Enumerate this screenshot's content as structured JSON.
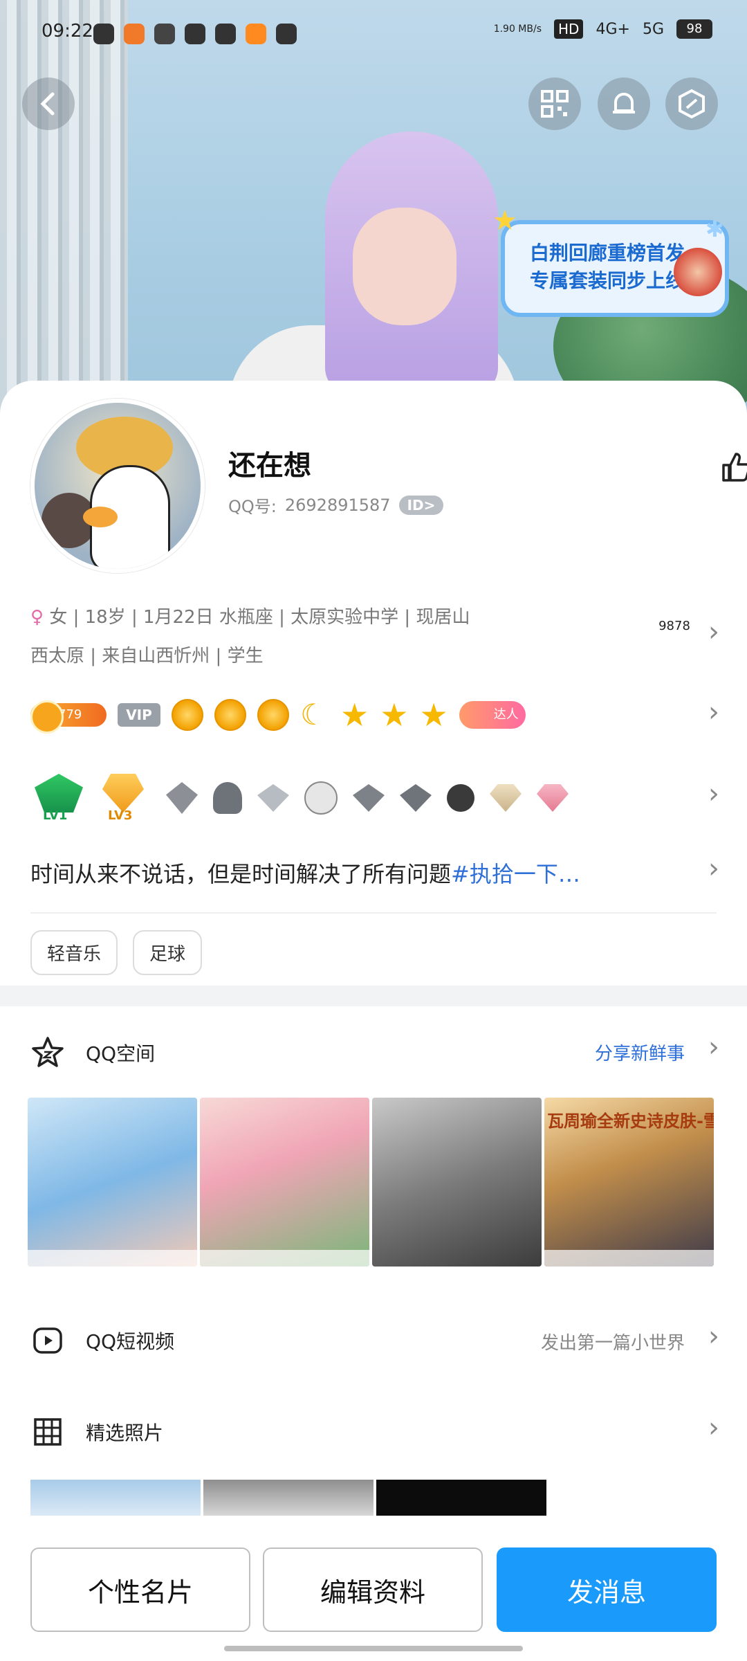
{
  "status_bar": {
    "time": "09:22",
    "net_speed": "1.90 MB/s",
    "hd": "HD",
    "net1": "4G+",
    "net2": "5G",
    "battery": "98"
  },
  "header": {
    "back_icon": "chevron-left-icon",
    "qr_icon": "qr-code-icon",
    "bell_icon": "bell-icon",
    "hex_icon": "hexagon-icon",
    "banner_line1": "白荆回廊重榜首发",
    "banner_line2": "专属套装同步上线"
  },
  "profile": {
    "nickname": "还在想",
    "qq_label": "QQ号:",
    "qq_number": "2692891587",
    "id_tag": "ID>",
    "likes": "9878"
  },
  "info": {
    "gender": "♀",
    "line1": "女 | 18岁 | 1月22日 水瓶座 | 太原实验中学 | 现居山",
    "line2": "西太原 | 来自山西忻州 | 学生"
  },
  "badges": {
    "level": "779",
    "vip": "VIP",
    "daren": "达人"
  },
  "medals": {
    "lv1": "LV1",
    "lv3": "LV3"
  },
  "signature": {
    "text": "时间从来不说话，但是时间解决了所有问题",
    "tag": "#执拾一下…"
  },
  "tags": [
    "轻音乐",
    "足球"
  ],
  "qzone": {
    "title": "QQ空间",
    "right": "分享新鲜事",
    "thumb4_header": "瓦周瑜全新史诗皮肤-雪夜扬"
  },
  "short_video": {
    "title": "QQ短视频",
    "right": "发出第一篇小世界"
  },
  "photos": {
    "title": "精选照片"
  },
  "bottom_buttons": {
    "card": "个性名片",
    "edit": "编辑资料",
    "message": "发消息"
  },
  "colors": {
    "primary": "#1a9bfb",
    "tag_blue": "#2e6fd8",
    "qzone_blue": "#2e6fd8"
  }
}
